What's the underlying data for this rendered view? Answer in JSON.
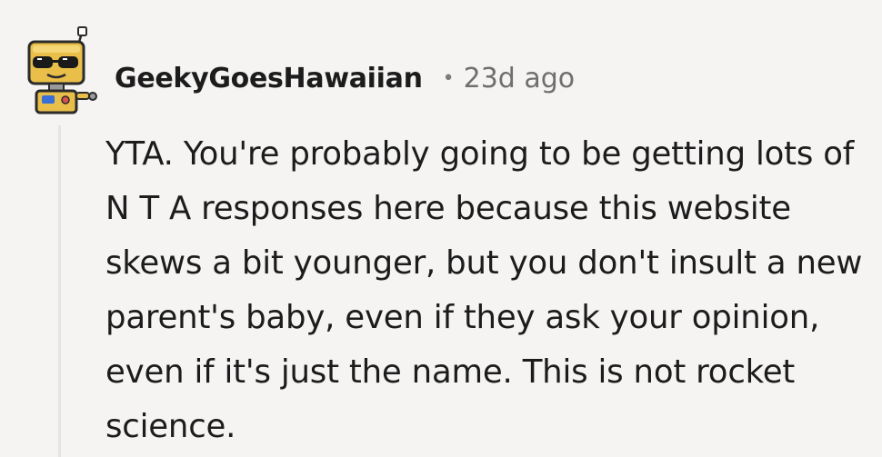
{
  "comment": {
    "username": "GeekyGoesHawaiian",
    "separator": "•",
    "timestamp": "23d ago",
    "body": "YTA. You're probably going to be getting lots of N T A responses here because this website skews a bit younger, but you don't insult a new parent's baby, even if they ask your opinion, even if it's just the name. This is not rocket science."
  },
  "avatar": {
    "icon": "robot-avatar-icon",
    "colors": {
      "body": "#e9bf4a",
      "outline": "#2b2b2b",
      "glasses": "#1a1a1a",
      "accent": "#3a6fd8"
    }
  }
}
